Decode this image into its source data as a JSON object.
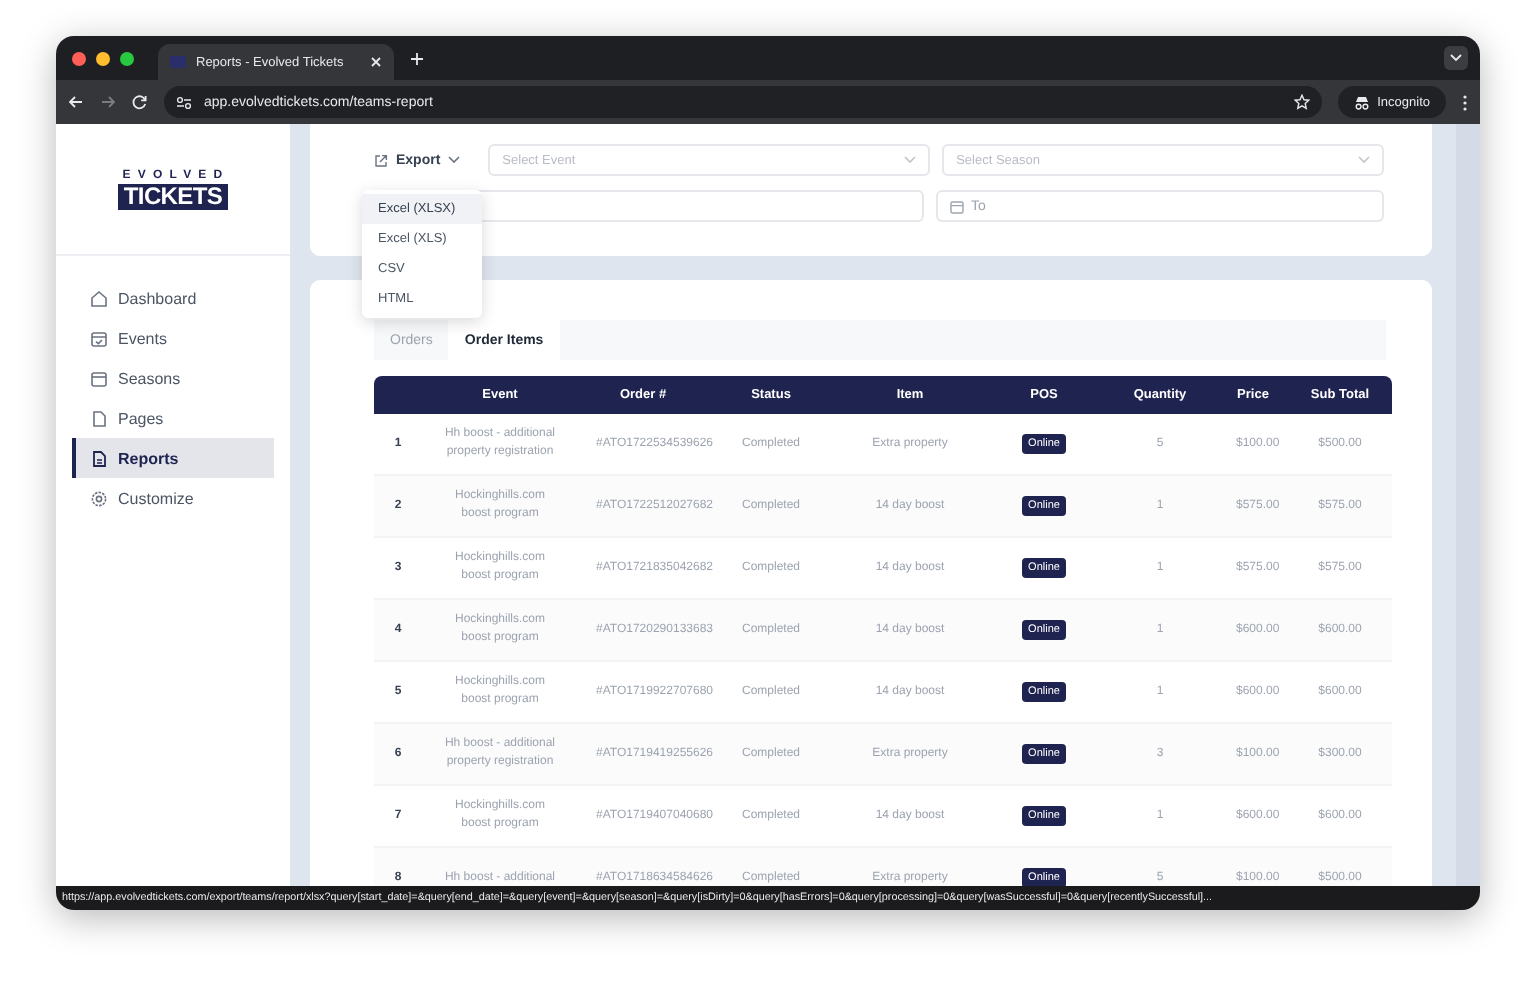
{
  "browser": {
    "tab_title": "Reports - Evolved Tickets",
    "url": "app.evolvedtickets.com/teams-report",
    "incognito_label": "Incognito",
    "status_url": "https://app.evolvedtickets.com/export/teams/report/xlsx?query[start_date]=&query[end_date]=&query[event]=&query[season]=&query[isDirty]=0&query[hasErrors]=0&query[processing]=0&query[wasSuccessful]=0&query[recentlySuccessful]..."
  },
  "sidebar": {
    "logo": {
      "top": "EVOLVED",
      "bottom": "TICKETS"
    },
    "items": [
      {
        "kind": "dashboard",
        "label": "Dashboard",
        "selected": false
      },
      {
        "kind": "events",
        "label": "Events",
        "selected": false
      },
      {
        "kind": "seasons",
        "label": "Seasons",
        "selected": false
      },
      {
        "kind": "pages",
        "label": "Pages",
        "selected": false
      },
      {
        "kind": "reports",
        "label": "Reports",
        "selected": true
      },
      {
        "kind": "customize",
        "label": "Customize",
        "selected": false
      }
    ]
  },
  "filters": {
    "export_label": "Export",
    "export_menu": [
      {
        "label": "Excel (XLSX)",
        "selected": true
      },
      {
        "label": "Excel (XLS)",
        "selected": false
      },
      {
        "label": "CSV",
        "selected": false
      },
      {
        "label": "HTML",
        "selected": false
      }
    ],
    "event_select": {
      "placeholder": "Select Event"
    },
    "season_select": {
      "placeholder": "Select Season"
    },
    "to_date": {
      "placeholder": "To"
    }
  },
  "tabs": [
    {
      "label": "Orders",
      "selected": false
    },
    {
      "label": "Order Items",
      "selected": true
    }
  ],
  "table": {
    "columns": [
      "",
      "Event",
      "Order #",
      "Status",
      "Item",
      "POS",
      "Quantity",
      "Price",
      "Sub Total"
    ],
    "rows": [
      {
        "number": "1",
        "event": "Hh boost - additional property registration",
        "order": "#ATO1722534539626",
        "status": "Completed",
        "item": "Extra property",
        "pos": "Online",
        "quantity": "5",
        "price": "$100.00",
        "subtotal": "$500.00"
      },
      {
        "number": "2",
        "event": "Hockinghills.com boost program",
        "order": "#ATO1722512027682",
        "status": "Completed",
        "item": "14 day boost",
        "pos": "Online",
        "quantity": "1",
        "price": "$575.00",
        "subtotal": "$575.00"
      },
      {
        "number": "3",
        "event": "Hockinghills.com boost program",
        "order": "#ATO1721835042682",
        "status": "Completed",
        "item": "14 day boost",
        "pos": "Online",
        "quantity": "1",
        "price": "$575.00",
        "subtotal": "$575.00"
      },
      {
        "number": "4",
        "event": "Hockinghills.com boost program",
        "order": "#ATO1720290133683",
        "status": "Completed",
        "item": "14 day boost",
        "pos": "Online",
        "quantity": "1",
        "price": "$600.00",
        "subtotal": "$600.00"
      },
      {
        "number": "5",
        "event": "Hockinghills.com boost program",
        "order": "#ATO1719922707680",
        "status": "Completed",
        "item": "14 day boost",
        "pos": "Online",
        "quantity": "1",
        "price": "$600.00",
        "subtotal": "$600.00"
      },
      {
        "number": "6",
        "event": "Hh boost - additional property registration",
        "order": "#ATO1719419255626",
        "status": "Completed",
        "item": "Extra property",
        "pos": "Online",
        "quantity": "3",
        "price": "$100.00",
        "subtotal": "$300.00"
      },
      {
        "number": "7",
        "event": "Hockinghills.com boost program",
        "order": "#ATO1719407040680",
        "status": "Completed",
        "item": "14 day boost",
        "pos": "Online",
        "quantity": "1",
        "price": "$600.00",
        "subtotal": "$600.00"
      },
      {
        "number": "8",
        "event": "Hh boost - additional",
        "order": "#ATO1718634584626",
        "status": "Completed",
        "item": "Extra property",
        "pos": "Online",
        "quantity": "5",
        "price": "$100.00",
        "subtotal": "$500.00"
      }
    ]
  }
}
